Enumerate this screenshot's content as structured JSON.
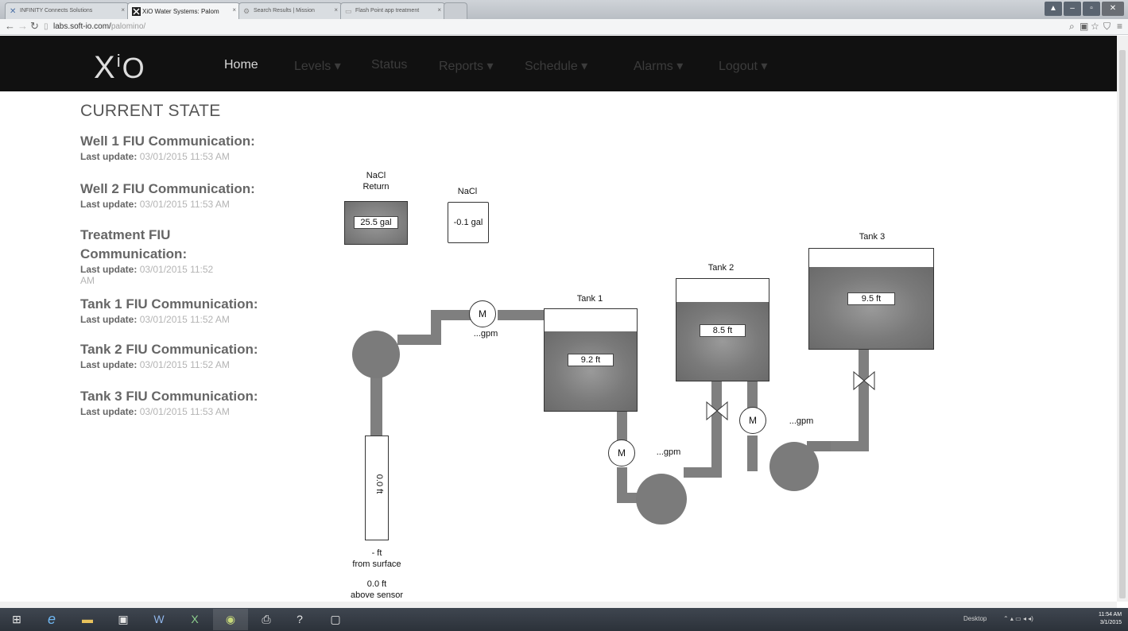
{
  "browser": {
    "tabs": [
      {
        "title": "INFINITY Connects Solutions",
        "active": false
      },
      {
        "title": "XiO Water Systems: Palom",
        "active": true
      },
      {
        "title": "Search Results | Mission",
        "active": false
      },
      {
        "title": "Flash Point app treatment",
        "active": false
      }
    ],
    "url_host": "labs.soft-io.com/",
    "url_path": "palomino/"
  },
  "nav": {
    "logo": {
      "x": "X",
      "i": "i",
      "o": "O"
    },
    "items": [
      "Home",
      "Levels ▾",
      "Status",
      "Reports ▾",
      "Schedule ▾",
      "Alarms ▾",
      "Logout ▾"
    ]
  },
  "current_state": {
    "title": "CURRENT STATE",
    "last_update_label": "Last update:",
    "items": [
      {
        "name": "Well 1 FIU Communication:",
        "last_update": "03/01/2015 11:53 AM"
      },
      {
        "name": "Well 2 FIU Communication:",
        "last_update": "03/01/2015 11:53 AM"
      },
      {
        "name": "Treatment FIU Communication:",
        "last_update": "03/01/2015 11:52 AM"
      },
      {
        "name": "Tank 1 FIU Communication:",
        "last_update": "03/01/2015 11:52 AM"
      },
      {
        "name": "Tank 2 FIU Communication:",
        "last_update": "03/01/2015 11:52 AM"
      },
      {
        "name": "Tank 3 FIU Communication:",
        "last_update": "03/01/2015 11:53 AM"
      }
    ]
  },
  "diagram": {
    "nacl_return": {
      "label": "NaCl\nReturn",
      "value": "25.5 gal"
    },
    "nacl": {
      "label": "NaCl",
      "value": "-0.1 gal"
    },
    "well": {
      "value": "0.0 ft",
      "depth": "- ft",
      "depth_label": "from surface",
      "above": "0.0 ft",
      "above_label": "above sensor"
    },
    "meter_label": "M",
    "flow_1": "...gpm",
    "flow_2": "...gpm",
    "flow_3": "...gpm",
    "tank1": {
      "name": "Tank 1",
      "level": "9.2 ft",
      "fill_fraction": 0.78
    },
    "tank2": {
      "name": "Tank 2",
      "level": "8.5 ft",
      "fill_fraction": 0.77
    },
    "tank3": {
      "name": "Tank 3",
      "level": "9.5 ft",
      "fill_fraction": 0.82
    },
    "colors": {
      "fill": "#7a7a7a",
      "pipe": "#7f7f7f",
      "pump": "#7b7b7b"
    }
  },
  "taskbar": {
    "clock_time": "11:54 AM",
    "clock_date": "3/1/2015",
    "tray_text": "Desktop"
  }
}
